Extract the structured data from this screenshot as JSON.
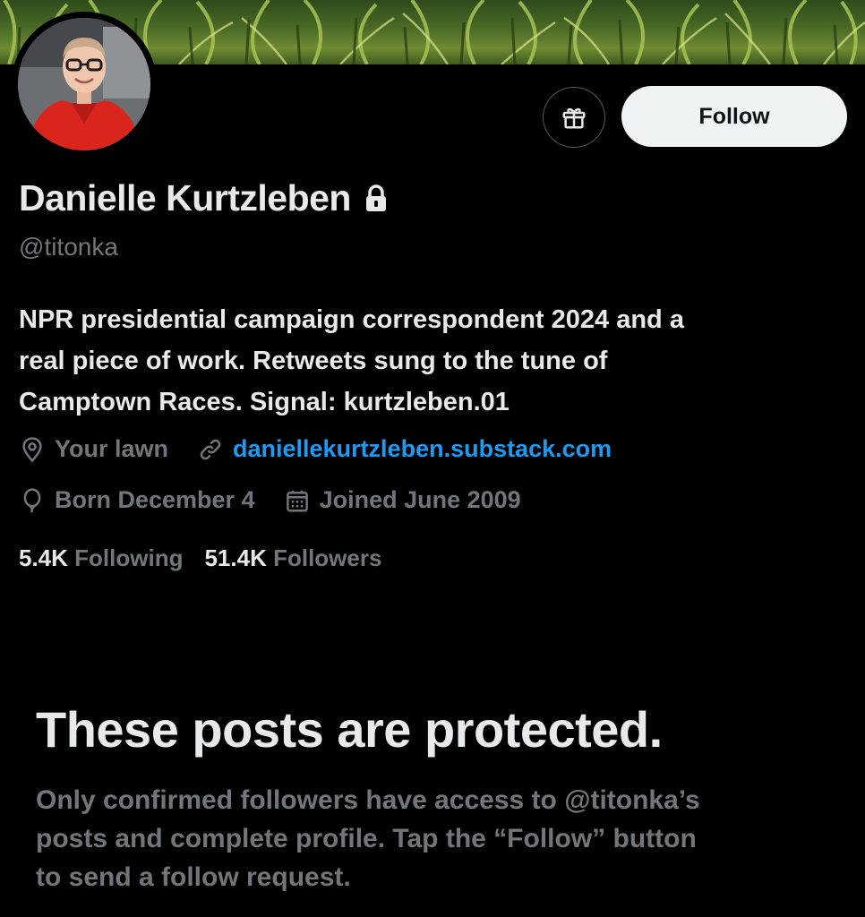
{
  "profile": {
    "name": "Danielle Kurtzleben",
    "handle": "@titonka",
    "bio_lines": [
      "NPR presidential campaign correspondent 2024 and a",
      "real piece of work. Retweets sung to the tune of",
      "Camptown Races. Signal: kurtzleben.01"
    ],
    "location": "Your lawn",
    "website": "daniellekurtzleben.substack.com",
    "birthday": "Born December 4",
    "joined": "Joined June 2009"
  },
  "actions": {
    "follow_label": "Follow",
    "gift_icon": "gift-icon"
  },
  "stats": {
    "following_count": "5.4K",
    "following_label": "Following",
    "followers_count": "51.4K",
    "followers_label": "Followers"
  },
  "protected": {
    "title": "These posts are protected.",
    "body_lines": [
      "Only confirmed followers have access to @titonka’s",
      "posts and complete profile. Tap the “Follow” button",
      "to send a follow request."
    ]
  },
  "colors": {
    "background": "#000000",
    "primary_text": "#e7e9ea",
    "secondary_text": "#71767b",
    "link": "#1d9bf0",
    "follow_button_bg": "#eff3f4"
  }
}
